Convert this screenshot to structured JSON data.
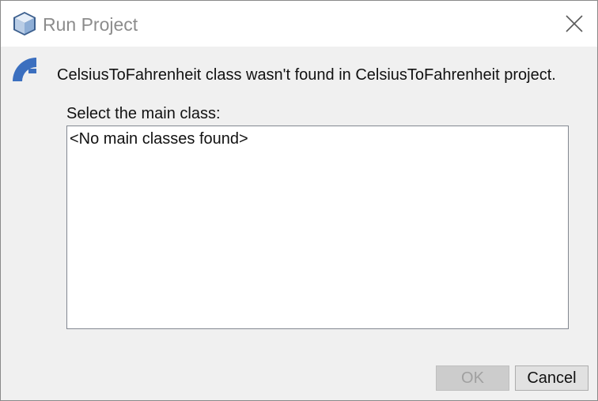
{
  "window": {
    "title": "Run Project",
    "icon": "netbeans-cube-icon"
  },
  "dialog": {
    "message": "CelsiusToFahrenheit class wasn't found in CelsiusToFahrenheit project.",
    "message_icon": "netbeans-logo-icon",
    "select_label": "Select the main class:",
    "list_items": [
      "<No main classes found>"
    ]
  },
  "buttons": {
    "ok_label": "OK",
    "ok_enabled": false,
    "cancel_label": "Cancel"
  },
  "colors": {
    "dialog_bg": "#f0f0f0",
    "titlebar_bg": "#ffffff",
    "title_text": "#8c8c8c",
    "icon_blue": "#3b6fbf"
  }
}
